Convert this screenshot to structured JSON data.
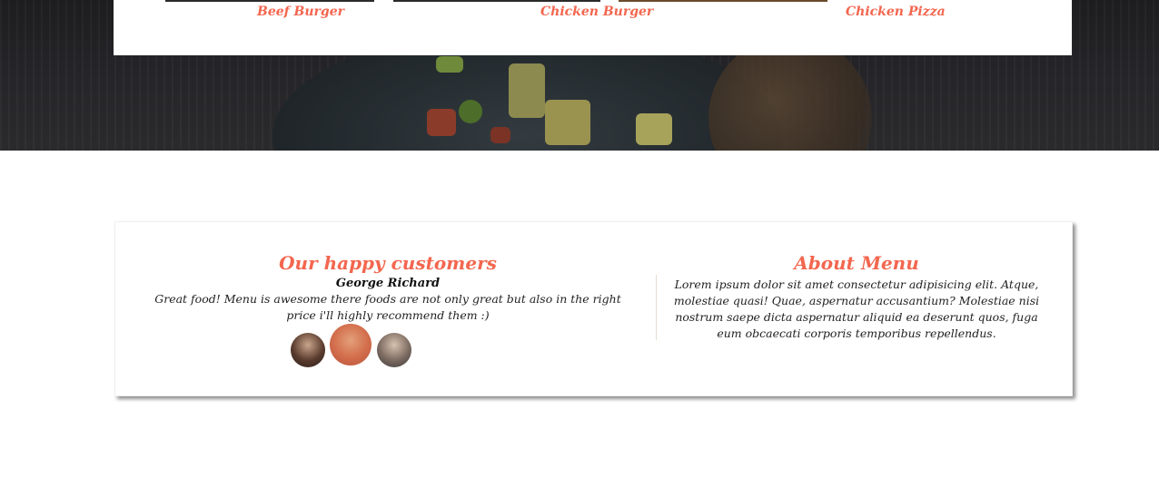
{
  "menu_items": [
    {
      "label": "Beef Burger"
    },
    {
      "label": "Chicken Burger"
    },
    {
      "label": "Chicken Pizza"
    }
  ],
  "customers": {
    "title": "Our happy customers",
    "name": "George Richard",
    "quote": "Great food! Menu is awesome there foods are not only great but also in the right price i'll highly recommend them :)",
    "avatars": [
      "avatar-woman",
      "avatar-man-smiling",
      "avatar-man-glasses"
    ]
  },
  "about": {
    "title": "About Menu",
    "text": "Lorem ipsum dolor sit amet consectetur adipisicing elit. Atque, molestiae quasi! Quae, aspernatur accusantium? Molestiae nisi nostrum saepe dicta aspernatur aliquid ea deserunt quos, fuga eum obcaecati corporis temporibus repellendus."
  },
  "colors": {
    "accent": "#f3664f",
    "hero_dark": "#1d1d1f"
  }
}
